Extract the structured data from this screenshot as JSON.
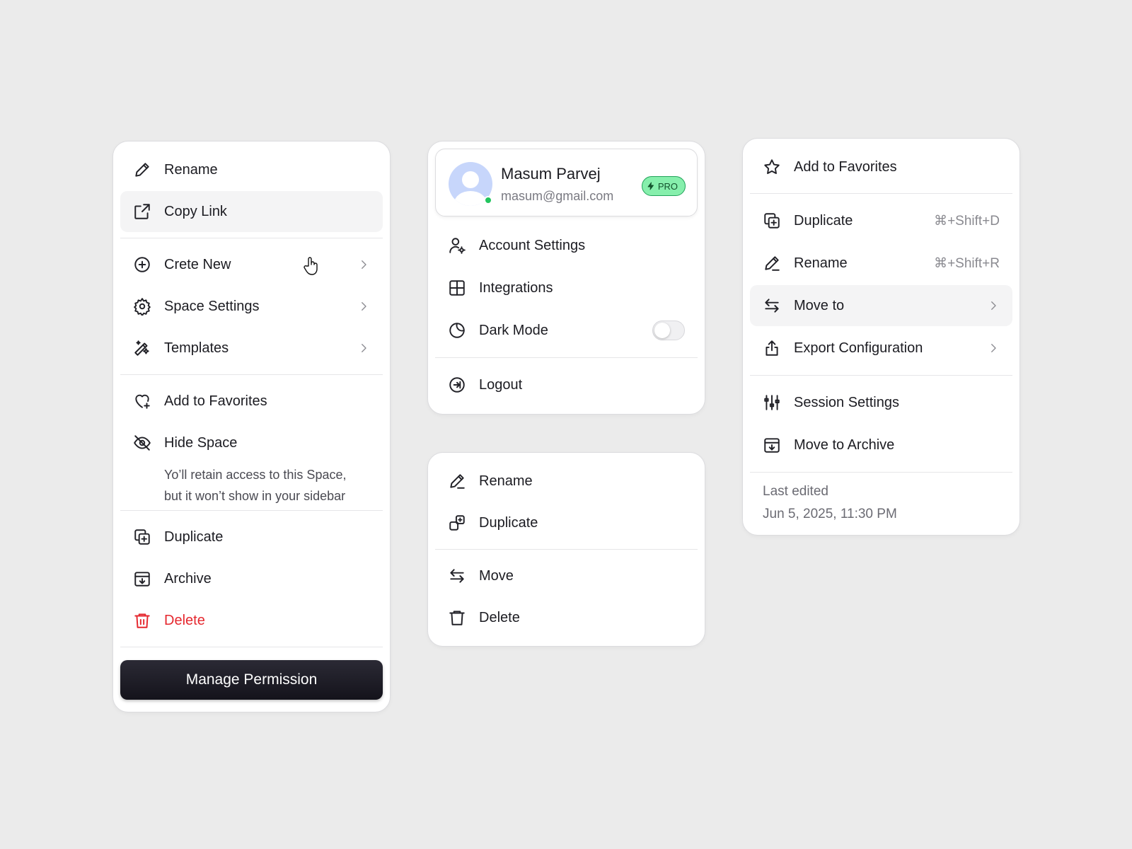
{
  "left_menu": {
    "items": [
      {
        "label": "Rename",
        "icon": "pencil-icon"
      },
      {
        "label": "Copy Link",
        "icon": "external-link-icon"
      },
      {
        "label": "Crete New",
        "icon": "plus-circle-icon"
      },
      {
        "label": "Space Settings",
        "icon": "gear-icon"
      },
      {
        "label": "Templates",
        "icon": "magic-wand-icon"
      },
      {
        "label": "Add to Favorites",
        "icon": "heart-plus-icon"
      },
      {
        "label": "Hide Space",
        "icon": "eye-off-icon"
      },
      {
        "label": "Duplicate",
        "icon": "duplicate-icon"
      },
      {
        "label": "Archive",
        "icon": "archive-icon"
      },
      {
        "label": "Delete",
        "icon": "trash-icon"
      }
    ],
    "hide_note_line1": "Yo’ll retain access to this Space,",
    "hide_note_line2": "but it won’t show in your sidebar",
    "manage_button": "Manage Permission"
  },
  "profile_menu": {
    "name": "Masum Parvej",
    "email": "masum@gmail.com",
    "badge": "PRO",
    "items": [
      {
        "label": "Account Settings",
        "icon": "user-gear-icon"
      },
      {
        "label": "Integrations",
        "icon": "grid-icon"
      },
      {
        "label": "Dark Mode",
        "icon": "moon-icon",
        "toggle": false
      },
      {
        "label": "Logout",
        "icon": "logout-icon"
      }
    ]
  },
  "small_menu": {
    "items": [
      {
        "label": "Rename",
        "icon": "pencil-icon"
      },
      {
        "label": "Duplicate",
        "icon": "duplicate-icon"
      },
      {
        "label": "Move",
        "icon": "swap-arrows-icon"
      },
      {
        "label": "Delete",
        "icon": "trash-icon"
      }
    ]
  },
  "right_menu": {
    "items": [
      {
        "label": "Add to Favorites",
        "icon": "star-icon"
      },
      {
        "label": "Duplicate",
        "icon": "duplicate-icon",
        "shortcut": "⌘+Shift+D"
      },
      {
        "label": "Rename",
        "icon": "pencil-icon",
        "shortcut": "⌘+Shift+R"
      },
      {
        "label": "Move to",
        "icon": "swap-arrows-icon"
      },
      {
        "label": "Export Configuration",
        "icon": "share-icon"
      },
      {
        "label": "Session Settings",
        "icon": "sliders-icon"
      },
      {
        "label": "Move to Archive",
        "icon": "archive-icon"
      }
    ],
    "last_edited_label": "Last edited",
    "last_edited_value": "Jun 5, 2025, 11:30 PM"
  },
  "colors": {
    "background": "#ebebeb",
    "danger": "#e5282f",
    "pro_badge": "#86efac",
    "online": "#22c55e"
  }
}
